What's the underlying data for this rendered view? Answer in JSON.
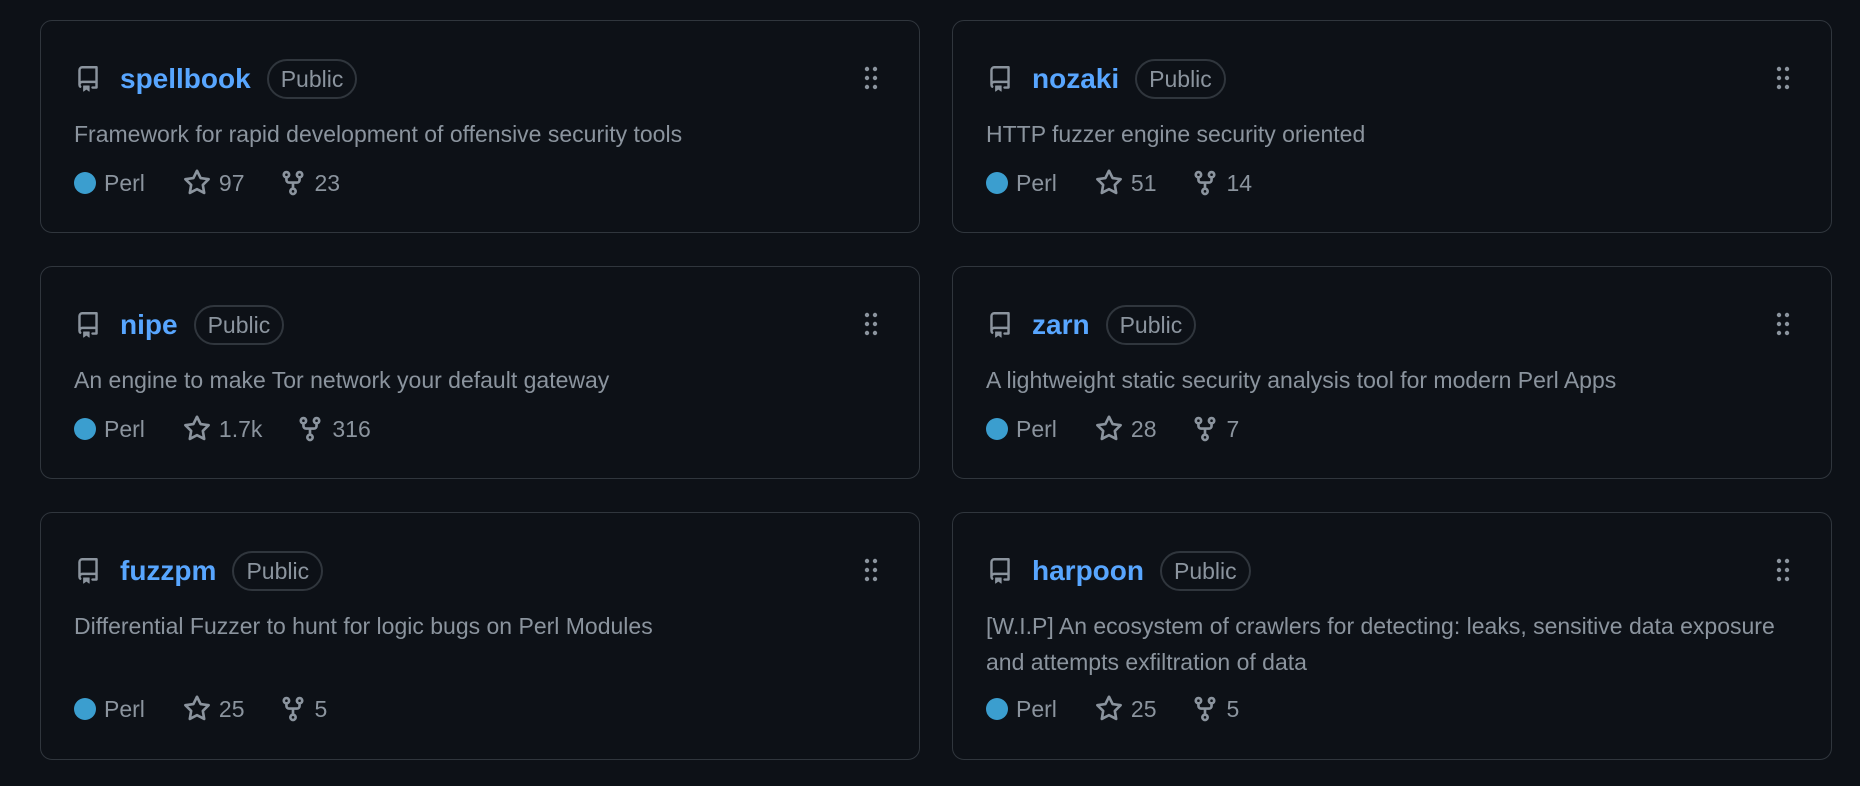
{
  "colors": {
    "background": "#0d1117",
    "border": "#30363d",
    "link": "#58a6ff",
    "muted": "#8b949e",
    "perl": "#3b9ecf"
  },
  "repos": [
    {
      "name": "spellbook",
      "visibility": "Public",
      "description": "Framework for rapid development of offensive security tools",
      "language": "Perl",
      "stars": "97",
      "forks": "23"
    },
    {
      "name": "nozaki",
      "visibility": "Public",
      "description": "HTTP fuzzer engine security oriented",
      "language": "Perl",
      "stars": "51",
      "forks": "14"
    },
    {
      "name": "nipe",
      "visibility": "Public",
      "description": "An engine to make Tor network your default gateway",
      "language": "Perl",
      "stars": "1.7k",
      "forks": "316"
    },
    {
      "name": "zarn",
      "visibility": "Public",
      "description": "A lightweight static security analysis tool for modern Perl Apps",
      "language": "Perl",
      "stars": "28",
      "forks": "7"
    },
    {
      "name": "fuzzpm",
      "visibility": "Public",
      "description": "Differential Fuzzer to hunt for logic bugs on Perl Modules",
      "language": "Perl",
      "stars": "25",
      "forks": "5"
    },
    {
      "name": "harpoon",
      "visibility": "Public",
      "description": "[W.I.P] An ecosystem of crawlers for detecting: leaks, sensitive data exposure and attempts exfiltration of data",
      "language": "Perl",
      "stars": "25",
      "forks": "5"
    }
  ]
}
